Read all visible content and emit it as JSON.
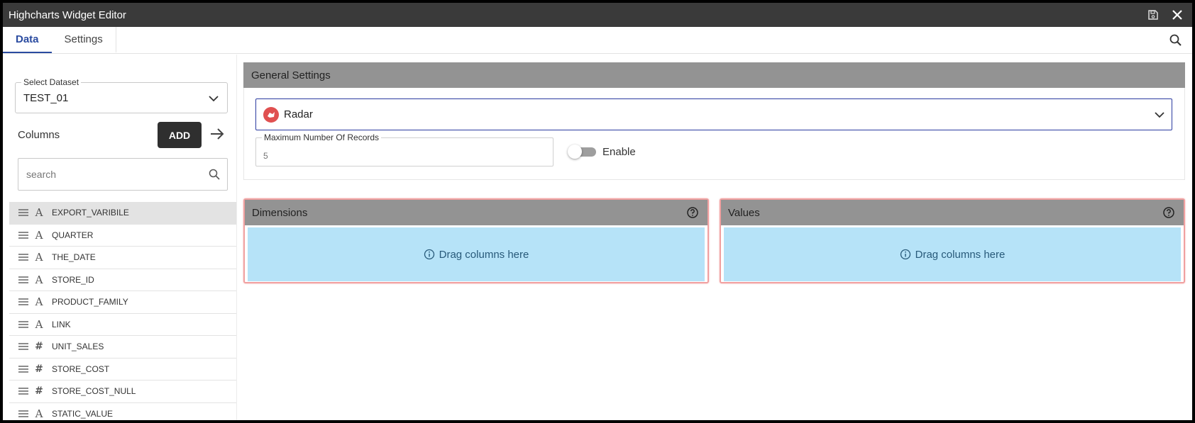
{
  "window": {
    "title": "Highcharts Widget Editor",
    "icons": {
      "save": "save-icon",
      "close": "close-icon"
    }
  },
  "tabs": [
    {
      "label": "Data",
      "active": true
    },
    {
      "label": "Settings",
      "active": false
    }
  ],
  "sidebar": {
    "dataset_label": "Select Dataset",
    "dataset_value": "TEST_01",
    "columns_label": "Columns",
    "add_label": "ADD",
    "search_placeholder": "search",
    "columns": [
      {
        "name": "EXPORT_VARIBILE",
        "type": "A"
      },
      {
        "name": "QUARTER",
        "type": "A"
      },
      {
        "name": "THE_DATE",
        "type": "A"
      },
      {
        "name": "STORE_ID",
        "type": "A"
      },
      {
        "name": "PRODUCT_FAMILY",
        "type": "A"
      },
      {
        "name": "LINK",
        "type": "A"
      },
      {
        "name": "UNIT_SALES",
        "type": "#"
      },
      {
        "name": "STORE_COST",
        "type": "#"
      },
      {
        "name": "STORE_COST_NULL",
        "type": "#"
      },
      {
        "name": "STATIC_VALUE",
        "type": "A"
      }
    ]
  },
  "general": {
    "header": "General Settings",
    "chart_type": "Radar",
    "max_records_label": "Maximum Number Of Records",
    "max_records_placeholder": "5",
    "toggle_label": "Enable"
  },
  "zones": {
    "dimensions": {
      "title": "Dimensions",
      "hint": "Drag columns here"
    },
    "values": {
      "title": "Values",
      "hint": "Drag columns here"
    }
  },
  "colors": {
    "accent": "#2a4ba0",
    "header_gray": "#939393",
    "dropzone_bg": "#b6e3f8",
    "dropzone_border": "#f0a0a0"
  }
}
